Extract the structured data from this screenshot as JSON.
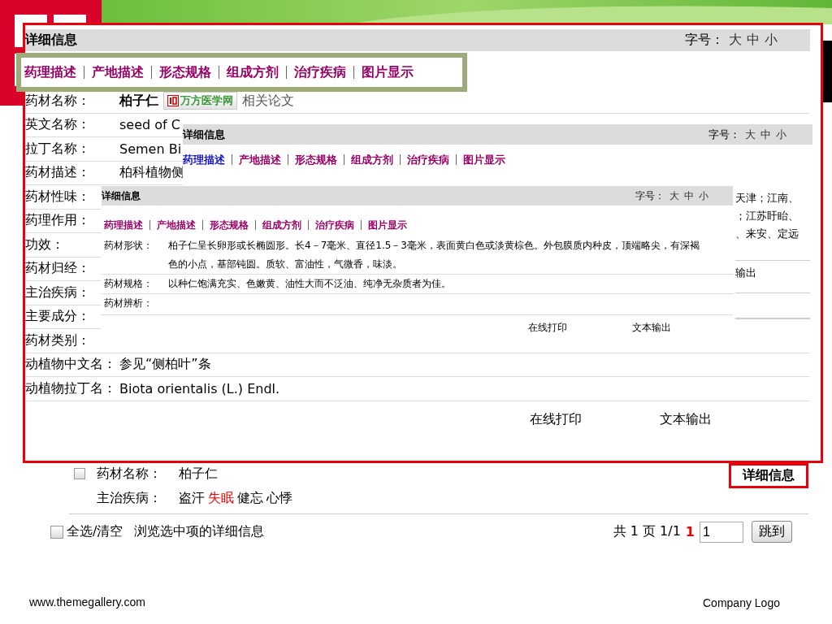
{
  "slide": {
    "footer_left": "www.themegallery.com",
    "footer_right": "Company Logo"
  },
  "result": {
    "item": {
      "checked": false,
      "fields": [
        {
          "label": "药材名称：",
          "values": [
            {
              "text": "柏子仁",
              "highlighted": false
            }
          ]
        },
        {
          "label": "主治疾病：",
          "values": [
            {
              "text": "盗汗",
              "highlighted": false
            },
            {
              "text": "失眠",
              "highlighted": true
            },
            {
              "text": "健忘",
              "highlighted": false
            },
            {
              "text": "心悸",
              "highlighted": false
            }
          ]
        }
      ],
      "detail_button": {
        "label": "详细信息",
        "highlighted": true
      }
    },
    "footer": {
      "select_all": {
        "label": "全选/清空",
        "checked": false
      },
      "browse_link": "浏览选中项的详细信息",
      "pager": {
        "total": "共 1 页 1/1",
        "current": "1",
        "page_input": "1",
        "go_button": "跳到"
      }
    }
  },
  "panels": [
    {
      "kind": "large",
      "title": "详细信息",
      "font_size": {
        "label": "字号：",
        "options": [
          "大",
          "中",
          "小"
        ]
      },
      "tabs_highlighted": true,
      "tabs": [
        {
          "label": "药理描述",
          "selected": false
        },
        {
          "label": "产地描述",
          "selected": false
        },
        {
          "label": "形态规格",
          "selected": false
        },
        {
          "label": "组成方剂",
          "selected": false
        },
        {
          "label": "治疗疾病",
          "selected": false
        },
        {
          "label": "图片显示",
          "selected": false
        }
      ],
      "rows": [
        {
          "kind": "title",
          "label": "药材名称：",
          "value": "柏子仁",
          "badge": "万方医学网",
          "link": "相关论文"
        },
        {
          "kind": "text",
          "label": "英文名称：",
          "value": "seed of C"
        },
        {
          "kind": "text",
          "label": "拉丁名称：",
          "value": "Semen Bi"
        },
        {
          "kind": "text",
          "label": "药材描述：",
          "value": "柏科植物侧"
        },
        {
          "kind": "text",
          "label": "药材性味："
        },
        {
          "kind": "text",
          "label": "药理作用："
        },
        {
          "kind": "text",
          "label": "功效："
        },
        {
          "kind": "text",
          "label": "药材归经："
        },
        {
          "kind": "text",
          "label": "主治疾病："
        },
        {
          "kind": "text",
          "label": "主要成分："
        },
        {
          "kind": "text",
          "label": "药材类别："
        },
        {
          "kind": "text",
          "label": "动植物中文名：",
          "value": "参见“侧柏叶”条"
        },
        {
          "kind": "text",
          "label": "动植物拉丁名：",
          "value": "Biota orientalis (L.) Endl."
        }
      ],
      "actions": [
        "在线打印",
        "文本输出"
      ]
    },
    {
      "kind": "medium",
      "title": "详细信息",
      "font_size": {
        "label": "字号：",
        "options": [
          "大",
          "中",
          "小"
        ]
      },
      "tabs_highlighted": false,
      "tabs": [
        {
          "label": "药理描述",
          "selected": true
        },
        {
          "label": "产地描述",
          "selected": false
        },
        {
          "label": "形态规格",
          "selected": false
        },
        {
          "label": "组成方剂",
          "selected": false
        },
        {
          "label": "治疗疾病",
          "selected": false
        },
        {
          "label": "图片显示",
          "selected": false
        }
      ],
      "fragment_rows": [
        [
          "天津；江南、",
          "；江苏盱眙、",
          "、来安、定远"
        ],
        [
          "输出"
        ]
      ]
    },
    {
      "kind": "small",
      "title": "详细信息",
      "font_size": {
        "label": "字号：",
        "options": [
          "大",
          "中",
          "小"
        ]
      },
      "tabs_highlighted": false,
      "tabs": [
        {
          "label": "药理描述",
          "selected": false
        },
        {
          "label": "产地描述",
          "selected": false
        },
        {
          "label": "形态规格",
          "selected": false
        },
        {
          "label": "组成方剂",
          "selected": false
        },
        {
          "label": "治疗疾病",
          "selected": false
        },
        {
          "label": "图片显示",
          "selected": false
        }
      ],
      "rows": [
        {
          "kind": "text",
          "label": "药材形状：",
          "value": "柏子仁呈长卵形或长椭圆形。长4－7毫米、直径1.5－3毫米，表面黄白色或淡黄棕色。外包膜质内种皮，顶端略尖，有深褐色的小点，基部钝圆。质软、富油性，气微香，味淡。"
        },
        {
          "kind": "text",
          "label": "药材规格：",
          "value": "以种仁饱满充实、色嫩黄、油性大而不泛油、纯净无杂质者为佳。"
        },
        {
          "kind": "text",
          "label": "药材辨析："
        }
      ],
      "actions": [
        "在线打印",
        "文本输出"
      ]
    }
  ]
}
